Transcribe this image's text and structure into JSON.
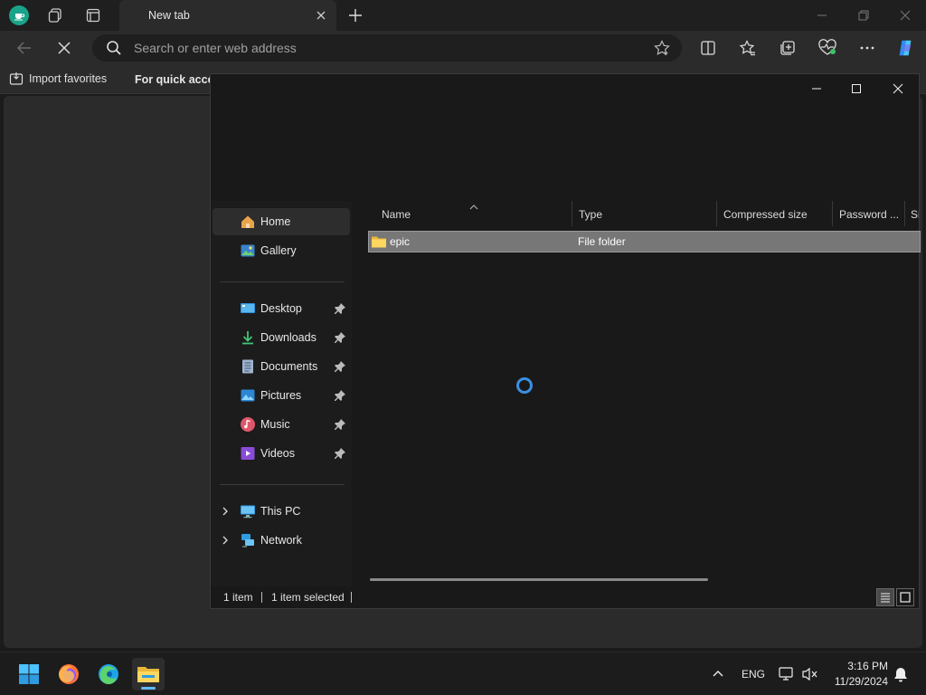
{
  "browser": {
    "tab_title": "New tab",
    "address_placeholder": "Search or enter web address",
    "favorites_bar": {
      "import_label": "Import favorites",
      "quick_access_text": "For quick acces"
    }
  },
  "explorer": {
    "nav_pane": {
      "items": [
        {
          "label": "Home",
          "icon": "home-icon"
        },
        {
          "label": "Gallery",
          "icon": "gallery-icon"
        },
        {
          "label": "Desktop",
          "icon": "desktop-icon"
        },
        {
          "label": "Downloads",
          "icon": "downloads-icon"
        },
        {
          "label": "Documents",
          "icon": "documents-icon"
        },
        {
          "label": "Pictures",
          "icon": "pictures-icon"
        },
        {
          "label": "Music",
          "icon": "music-icon"
        },
        {
          "label": "Videos",
          "icon": "videos-icon"
        },
        {
          "label": "This PC",
          "icon": "this-pc-icon"
        },
        {
          "label": "Network",
          "icon": "network-icon"
        }
      ]
    },
    "columns": [
      "Name",
      "Type",
      "Compressed size",
      "Password ...",
      "Si"
    ],
    "files": [
      {
        "name": "epic",
        "type": "File folder"
      }
    ],
    "status": {
      "item_count": "1 item",
      "selected": "1 item selected"
    }
  },
  "taskbar": {
    "language": "ENG",
    "time": "3:16 PM",
    "date": "11/29/2024"
  },
  "colors": {
    "accent": "#3b8fe0",
    "profile": "#1aa389",
    "selection": "#777777"
  }
}
